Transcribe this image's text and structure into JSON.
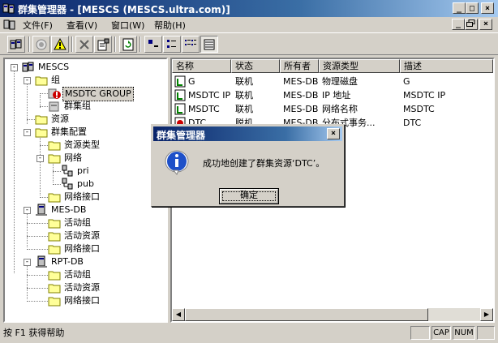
{
  "window": {
    "title": "群集管理器 - [MESCS (MESCS.ultra.com)]",
    "controls": {
      "minimize": "_",
      "maximize": "□",
      "close": "×"
    }
  },
  "menu": {
    "items": [
      "文件(F)",
      "查看(V)",
      "窗口(W)",
      "帮助(H)"
    ],
    "mdi_controls": {
      "minimize": "_",
      "restore": "🗗",
      "close": "×"
    }
  },
  "toolbar": {
    "buttons": [
      "open-connection-icon",
      "bring-online-icon",
      "take-offline-icon",
      "delete-icon",
      "properties-icon",
      "refresh-icon",
      "large-icons-icon",
      "small-icons-icon",
      "list-view-icon",
      "details-view-icon"
    ]
  },
  "tree": {
    "root": "MESCS",
    "groups": "组",
    "msdtc_group": "MSDTC GROUP",
    "cluster_group": "群集组",
    "resources": "资源",
    "cluster_config": "群集配置",
    "resource_types": "资源类型",
    "networks": "网络",
    "net_pri": "pri",
    "net_pub": "pub",
    "net_interfaces": "网络接口",
    "node1": "MES-DB",
    "node1_active_groups": "活动组",
    "node1_active_resources": "活动资源",
    "node1_net_interfaces": "网络接口",
    "node2": "RPT-DB",
    "node2_active_groups": "活动组",
    "node2_active_resources": "活动资源",
    "node2_net_interfaces": "网络接口"
  },
  "list": {
    "columns": [
      "名称",
      "状态",
      "所有者",
      "资源类型",
      "描述"
    ],
    "rows": [
      {
        "name": "G",
        "status": "联机",
        "owner": "MES-DB",
        "type": "物理磁盘",
        "desc": "G"
      },
      {
        "name": "MSDTC IP",
        "status": "联机",
        "owner": "MES-DB",
        "type": "IP 地址",
        "desc": "MSDTC IP"
      },
      {
        "name": "MSDTC",
        "status": "联机",
        "owner": "MES-DB",
        "type": "网络名称",
        "desc": "MSDTC"
      },
      {
        "name": "DTC",
        "status": "脱机",
        "owner": "MES-DB",
        "type": "分布式事务...",
        "desc": "DTC"
      }
    ]
  },
  "statusbar": {
    "message": "按 F1 获得帮助",
    "cap": "CAP",
    "num": "NUM"
  },
  "dialog": {
    "title": "群集管理器",
    "message": "成功地创建了群集资源‘DTC’。",
    "ok_label": "确定",
    "close": "×"
  },
  "colors": {
    "titlebar": "#0a246a",
    "face": "#d4d0c8",
    "error_badge": "#cc0000"
  }
}
